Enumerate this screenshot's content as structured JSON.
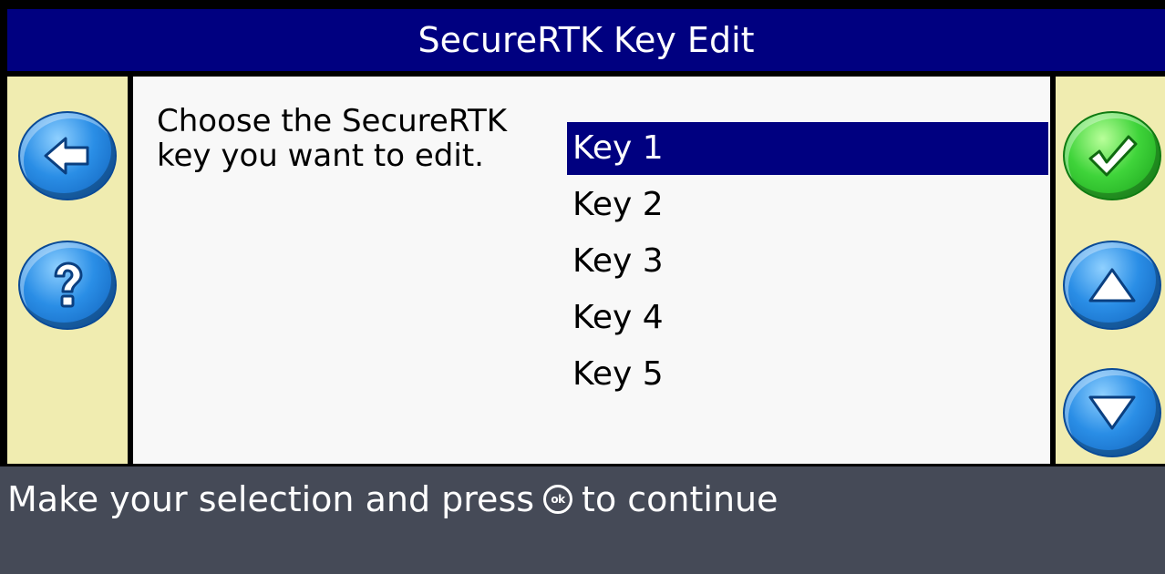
{
  "title": "SecureRTK Key Edit",
  "instruction": "Choose the SecureRTK key you want to edit.",
  "keys": [
    {
      "label": "Key 1",
      "selected": true
    },
    {
      "label": "Key 2",
      "selected": false
    },
    {
      "label": "Key 3",
      "selected": false
    },
    {
      "label": "Key 4",
      "selected": false
    },
    {
      "label": "Key 5",
      "selected": false
    }
  ],
  "footer": {
    "before_icon": "Make your selection and press",
    "icon_text": "ok",
    "after_icon": "to continue"
  },
  "icons": {
    "back": "back-arrow-icon",
    "help": "question-mark-icon",
    "accept": "checkmark-icon",
    "up": "up-triangle-icon",
    "down": "down-triangle-icon",
    "ok": "ok-button-icon"
  },
  "colors": {
    "title_bar": "#000080",
    "selection": "#000080",
    "side_panel": "#f0ecb0",
    "footer": "#454a57"
  }
}
